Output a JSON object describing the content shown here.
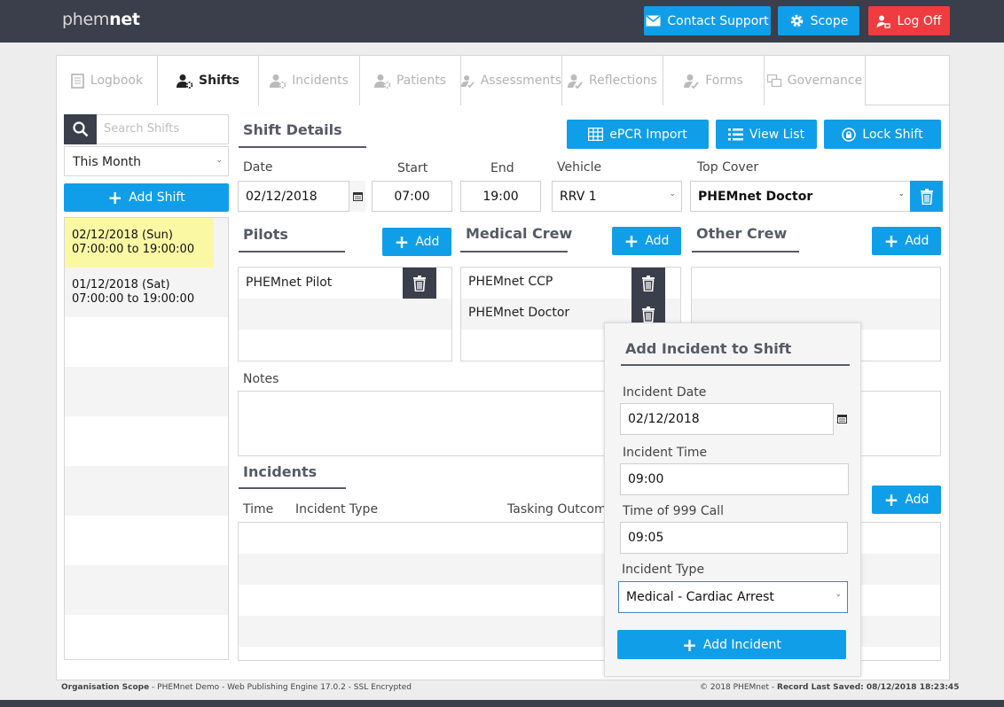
{
  "app": {
    "logo_light": "phem",
    "logo_bold": "net",
    "contact_label": "Contact Support",
    "scope_label": "Scope",
    "logoff_label": "Log Off"
  },
  "tabs": [
    {
      "label": "Logbook",
      "icon": "book-icon"
    },
    {
      "label": "Shifts",
      "icon": "user-cog-icon"
    },
    {
      "label": "Incidents",
      "icon": "user-cog-icon"
    },
    {
      "label": "Patients",
      "icon": "user-cog-icon"
    },
    {
      "label": "Assessments",
      "icon": "user-check-icon"
    },
    {
      "label": "Reflections",
      "icon": "user-check-icon"
    },
    {
      "label": "Forms",
      "icon": "user-check-icon"
    },
    {
      "label": "Governance",
      "icon": "governance-icon"
    }
  ],
  "sidebar": {
    "search_placeholder": "Search Shifts",
    "filter_value": "This Month",
    "add_shift_label": "Add Shift",
    "shifts": [
      {
        "date": "02/12/2018 (Sun)",
        "time": "07:00:00 to 19:00:00"
      },
      {
        "date": "01/12/2018 (Sat)",
        "time": "07:00:00 to 19:00:00"
      }
    ]
  },
  "shift_details": {
    "title": "Shift Details",
    "epcr_label": "ePCR Import",
    "view_list_label": "View List",
    "lock_label": "Lock Shift",
    "date_label": "Date",
    "date_value": "02/12/2018",
    "start_label": "Start",
    "start_value": "07:00",
    "end_label": "End",
    "end_value": "19:00",
    "vehicle_label": "Vehicle",
    "vehicle_value": "RRV 1",
    "top_cover_label": "Top Cover",
    "top_cover_value": "PHEMnet Doctor"
  },
  "pilots": {
    "title": "Pilots",
    "add_label": "Add",
    "items": [
      "PHEMnet Pilot"
    ]
  },
  "medical_crew": {
    "title": "Medical Crew",
    "add_label": "Add",
    "items": [
      "PHEMnet CCP",
      "PHEMnet Doctor"
    ]
  },
  "other_crew": {
    "title": "Other Crew",
    "add_label": "Add",
    "items": []
  },
  "notes": {
    "label": "Notes"
  },
  "incidents": {
    "title": "Incidents",
    "add_label": "Add",
    "columns": [
      "Time",
      "Incident Type",
      "Tasking Outcome"
    ]
  },
  "popup": {
    "title": "Add Incident to Shift",
    "date_label": "Incident Date",
    "date_value": "02/12/2018",
    "time_label": "Incident Time",
    "time_value": "09:00",
    "call_label": "Time of 999 Call",
    "call_value": "09:05",
    "type_label": "Incident Type",
    "type_value": "Medical - Cardiac Arrest",
    "submit_label": "Add Incident"
  },
  "footer": {
    "left_bold": "Organisation Scope",
    "left_rest": " - PHEMnet Demo - Web Publishing Engine 17.0.2 - SSL Encrypted",
    "right_text": "© 2018 PHEMnet - ",
    "right_bold": "Record Last Saved: 08/12/2018 18:23:45"
  }
}
